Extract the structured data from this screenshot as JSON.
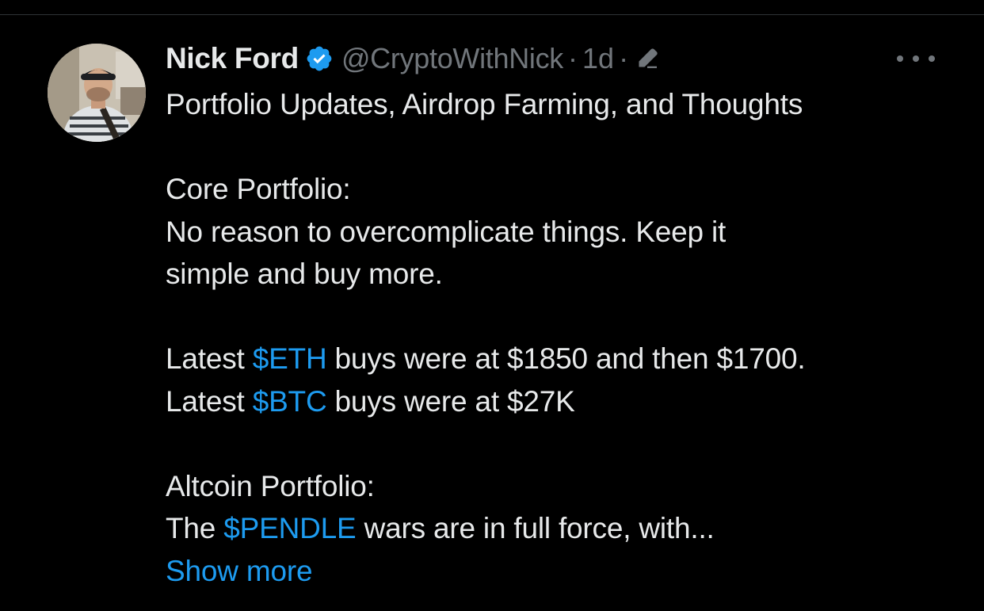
{
  "author": {
    "display_name": "Nick Ford",
    "handle": "@CryptoWithNick",
    "timestamp": "1d",
    "separator": "·",
    "verified": true,
    "avatar_icon": "profile-photo"
  },
  "icons": {
    "verified": "verified-badge-icon",
    "edited": "edit-pencil-icon",
    "more": "more-options-icon"
  },
  "colors": {
    "background": "#000000",
    "text": "#e7e9ea",
    "muted": "#71767b",
    "accent": "#1d9bf0"
  },
  "tweet": {
    "title": "Portfolio Updates, Airdrop Farming, and Thoughts",
    "core_heading": "Core Portfolio:",
    "core_line1": "No reason to overcomplicate things. Keep it",
    "core_line2": "simple and buy more.",
    "eth_prefix": "Latest ",
    "eth_tag": "$ETH",
    "eth_suffix": " buys were at $1850 and then $1700.",
    "btc_prefix": "Latest ",
    "btc_tag": "$BTC",
    "btc_suffix": " buys were at $27K",
    "alt_heading": "Altcoin Portfolio:",
    "pendle_prefix": "The ",
    "pendle_tag": "$PENDLE",
    "pendle_suffix": " wars are in full force, with...",
    "show_more": "Show more"
  }
}
